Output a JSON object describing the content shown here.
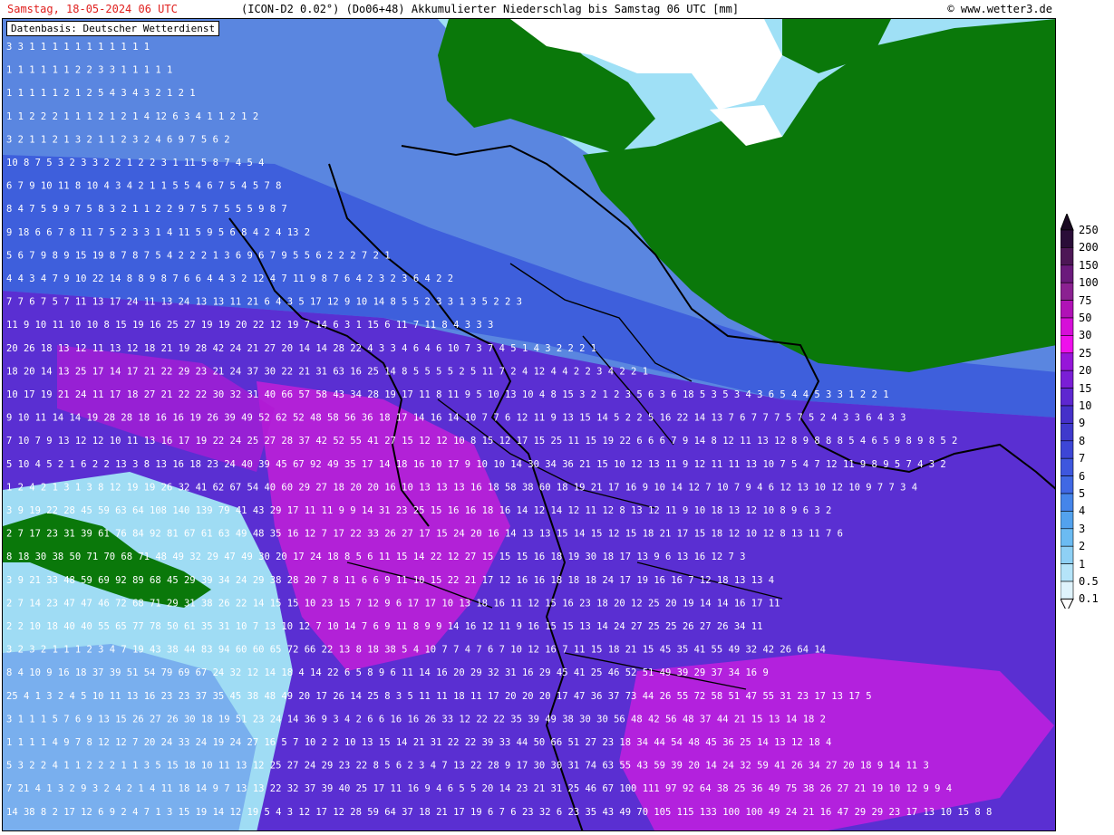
{
  "header": {
    "date_text": "Samstag, 18-05-2024  06 UTC",
    "model_text": "(ICON-D2 0.02°) (Do06+48) Akkumulierter Niederschlag bis Samstag 06 UTC [mm]",
    "copyright_text": "© www.wetter3.de"
  },
  "map": {
    "source_label": "Datenbasis: Deutscher Wetterdienst",
    "land_color": "#0a780a",
    "border_color": "#000000",
    "value_text_color": "#ffffff",
    "grid_values": [
      "3 3 1 1 1 1 1 1 1 1 1 1 1",
      "1 1 1 1 1 1 2 2 3 3 1 1 1 1 1",
      "1 1 1 1 1 2 1 2 5 4 3 4 3 2 1 2 1",
      "1 1 2 2 2 1 1 1 2 1 2 1 4 12 6 3 4 1 1 2 1 2",
      "3 2 1 1 2 1 3 2 1 1 2 3 2 4 6 9 7 5 6 2",
      "10 8 7 5 3 2 3 3 2 2 1 2 2 3 1 11 5 8 7 4 5 4",
      "6 7 9 10 11 8 10 4 3 4 2 1 1 5 5 4 6 7 5 4 5 7 8",
      "8 4 7 5 9 9 7 5 8 3 2 1 1 2 2 9 7 5 7 5 5 5 9 8 7",
      "9 18 6 6 7 8 11 7 5 2 3 3 1 4 11 5 9 5 6 8 4 2 4 13 2",
      "5 6 7 9 8 9 15 19 8 7 8 7 5 4 2 2 2 1 3 6 9 6 7 9 5 5 6 2 2 2 7 2 1",
      "4 4 3 4 7 9 10 22 14 8 8 9 8 7 6 6 4 4 3 2 12 4 7 11 9 8 7 6 4 2 3 2 3 6 4 2 2",
      "7 7 6 7 5 7 11 13 17 24 11 13 24 13 13 11 21 6 4 3 5 17 12 9 10 14 8 5 5 2 3 3 1 3 5 2 2 3",
      "11 9 10 11 10 10 8 15 19 16 25 27 19 19 20 22 12 19 7 14 6 3 1 15 6 11 7 11 8 4 3 3 3",
      "20 26 18 13 12 11 13 12 18 21 19 28 42 24 21 27 20 14 14 28 22 4 3 3 4 6 4 6 10 7 3 7 4 5 1 4 3 2 2 2 1",
      "18 20 14 13 25 17 14 17 21 22 29 23 21 24 37 30 22 21 31 63 16 25 14 8 5 5 5 5 2 5 11 7 2 4 12 4 4 2 2 3 4 2 2 1",
      "10 17 19 21 24 11 17 18 27 21 22 22 30 32 31 40 66 57 58 43 34 28 19 17 11 8 11 9 5 10 13 10 4 8 15 3 2 1 2 3 5 6 3 6 18 5 3 5 3 4 3 6 5 4 4 5 3 3 1 2 2 1",
      "9 10 11 14 14 19 28 28 18 16 16 19 26 39 49 52 62 52 48 58 56 36 18 17 14 16 14 10 7 7 6 12 11 9 13 15 14 5 2 2 5 16 22 14 13 7 6 7 7 7 5 7 5 2 4 3 3 6 4 3 3",
      "7 10 7 9 13 12 12 10 11 13 16 17 19 22 24 25 27 28 37 42 52 55 41 27 15 12 12 10 8 15 12 17 15 25 11 15 19 22 6 6 6 7 9 14 8 12 11 13 12 8 9 8 8 8 5 4 6 5 9 8 9 8 5 2",
      "5 10 4 5 2 1 6 2 2 13 3 8 13 16 18 23 24 40 39 45 67 92 49 35 17 14 18 16 10 17 9 10 10 14 30 34 36 21 15 10 12 13 11 9 12 11 11 13 10 7 5 4 7 12 11 9 8 9 5 7 4 3 2",
      "1 2 4 2 1 3 1 3 8 12 19 19 26 32 41 62 67 54 40 60 29 27 18 20 20 16 10 13 13 13 16 18 58 38 60 18 19 21 17 16 9 10 14 12 7 10 7 9 4 6 12 13 10 12 10 9 7 7 3 4",
      "3 9 19 22 28 45 59 63 64 108 140 139 79 41 43 29 17 11 11 9 9 14 31 23 25 15 16 16 18 16 14 12 14 12 11 12 8 13 12 11 9 10 18 13 12 10 8 9 6 3 2",
      "2 7 17 23 31 39 61 76 84 92 81 67 61 63 49 48 35 16 12 7 17 22 33 26 27 17 15 24 20 16 14 13 13 15 14 15 12 15 18 21 17 15 18 12 10 12 8 13 11 7 6",
      "8 18 30 38 50 71 70 68 71 48 49 32 29 47 49 30 20 17 24 18 8 5 6 11 15 14 22 12 27 15 15 15 16 18 19 30 18 17 13 9 6 13 16 12 7 3",
      "3 9 21 33 48 59 69 92 89 68 45 29 39 34 24 29 38 28 20 7 8 11 6 6 9 11 10 15 22 21 17 12 16 16 18 18 18 24 17 19 16 16 7 12 18 13 13 4",
      "2 7 14 23 47 47 46 72 68 71 29 31 38 26 22 14 15 15 10 23 15 7 12 9 6 17 17 10 13 18 16 11 12 15 16 23 18 20 12 25 20 19 14 14 16 17 11",
      "2 2 10 18 40 40 55 65 77 78 50 61 35 31 10 7 13 10 12 7 10 14 7 6 9 11 8 9 9 14 16 12 11 9 16 15 15 13 14 24 27 25 25 26 27 26 34 11",
      "3 2 3 2 1 1 1 2 3 4 7 19 43 38 44 83 94 60 60 65 72 66 22 13 8 18 38 5 4 10 7 7 4 7 6 7 10 12 16 7 11 15 18 21 15 45 35 41 55 49 32 42 26 64 14",
      "8 4 10 9 16 18 37 39 51 54 79 69 67 24 32 12 14 18 4 14 22 6 5 8 9 6 11 14 16 20 29 32 31 16 29 45 41 25 46 52 51 49 39 29 37 34 16 9",
      "25 4 1 3 2 4 5 10 11 13 16 23 23 37 35 45 38 48 49 20 17 26 14 25 8 3 5 11 11 18 11 17 20 20 20 17 47 36 37 73 44 26 55 72 58 51 47 55 31 23 17 13 17 5",
      "3 1 1 1 5 7 6 9 13 15 26 27 26 30 18 19 51 23 24 14 36 9 3 4 2 6 6 16 16 26 33 12 22 22 35 39 49 38 30 30 56 48 42 56 48 37 44 21 15 13 14 18 2",
      "1 1 1 1 4 9 7 8 12 12 7 20 24 33 24 19 24 27 16 5 7 10 2 2 10 13 15 14 21 31 22 22 39 33 44 50 66 51 27 23 18 34 44 54 48 45 36 25 14 13 12 18 4",
      "5 3 2 2 4 1 1 2 2 2 1 1 3 5 15 18 10 11 13 12 25 27 24 29 23 22 8 5 6 2 3 4 7 13 22 28 9 17 30 30 31 74 63 55 43 59 39 20 14 24 32 59 41 26 34 27 20 18 9 14 11 3",
      "7 21 4 1 3 2 9 3 2 4 2 1 4 11 18 14 9 7 13 13 22 32 37 39 40 25 17 11 16 9 4 6 5 5 20 14 23 21 31 25 46 67 100 111 97 92 64 38 25 36 49 75 38 26 27 21 19 10 12 9 9 4",
      "14 38 8 2 17 12 6 9 2 4 7 1 3 15 19 14 12 19 5 4 3 12 17 12 28 59 64 37 18 21 17 19 6 7 6 23 32 6 23 35 43 49 70 105 115 133 100 100 49 24 21 16 47 29 29 23 17 13 10 15 8 8"
    ]
  },
  "legend": {
    "labels": [
      "250",
      "200",
      "150",
      "100",
      "75",
      "50",
      "30",
      "25",
      "20",
      "15",
      "10",
      "9",
      "8",
      "7",
      "6",
      "5",
      "4",
      "3",
      "2",
      "1",
      "0.5",
      "0.1"
    ],
    "colors": [
      "#2a0d38",
      "#4d1756",
      "#6b1a7c",
      "#8b2191",
      "#b012b6",
      "#d60fd8",
      "#ef10ec",
      "#9616d9",
      "#7a1ed6",
      "#5e27d0",
      "#4530c9",
      "#3f39cc",
      "#3d46d6",
      "#3e57de",
      "#4068e4",
      "#4585ea",
      "#53a2ee",
      "#6bbbf2",
      "#8ed0f5",
      "#b5e4f9",
      "#dff3fc"
    ]
  }
}
